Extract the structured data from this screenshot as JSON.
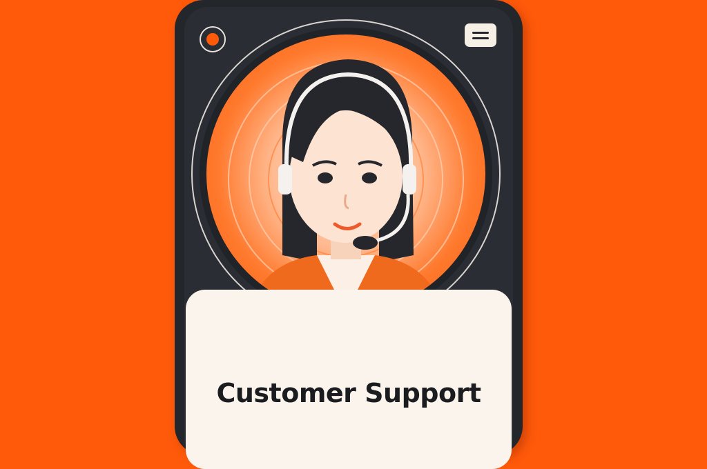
{
  "card": {
    "title": "Customer Support"
  },
  "icons": {
    "logo": "logo-icon",
    "menu": "menu-icon",
    "headset": "headset-icon"
  },
  "colors": {
    "background": "#ff5a0a",
    "card_frame": "#23262b",
    "card_panel": "#fbf4ec",
    "accent": "#ff5a0a"
  }
}
